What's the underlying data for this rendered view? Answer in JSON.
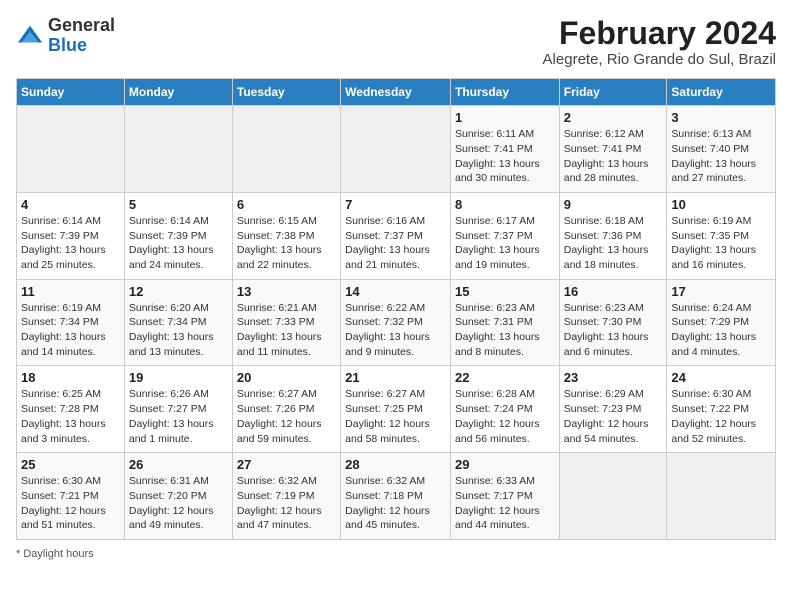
{
  "logo": {
    "general": "General",
    "blue": "Blue"
  },
  "header": {
    "month_year": "February 2024",
    "location": "Alegrete, Rio Grande do Sul, Brazil"
  },
  "days_of_week": [
    "Sunday",
    "Monday",
    "Tuesday",
    "Wednesday",
    "Thursday",
    "Friday",
    "Saturday"
  ],
  "weeks": [
    [
      {
        "num": "",
        "info": ""
      },
      {
        "num": "",
        "info": ""
      },
      {
        "num": "",
        "info": ""
      },
      {
        "num": "",
        "info": ""
      },
      {
        "num": "1",
        "info": "Sunrise: 6:11 AM\nSunset: 7:41 PM\nDaylight: 13 hours and 30 minutes."
      },
      {
        "num": "2",
        "info": "Sunrise: 6:12 AM\nSunset: 7:41 PM\nDaylight: 13 hours and 28 minutes."
      },
      {
        "num": "3",
        "info": "Sunrise: 6:13 AM\nSunset: 7:40 PM\nDaylight: 13 hours and 27 minutes."
      }
    ],
    [
      {
        "num": "4",
        "info": "Sunrise: 6:14 AM\nSunset: 7:39 PM\nDaylight: 13 hours and 25 minutes."
      },
      {
        "num": "5",
        "info": "Sunrise: 6:14 AM\nSunset: 7:39 PM\nDaylight: 13 hours and 24 minutes."
      },
      {
        "num": "6",
        "info": "Sunrise: 6:15 AM\nSunset: 7:38 PM\nDaylight: 13 hours and 22 minutes."
      },
      {
        "num": "7",
        "info": "Sunrise: 6:16 AM\nSunset: 7:37 PM\nDaylight: 13 hours and 21 minutes."
      },
      {
        "num": "8",
        "info": "Sunrise: 6:17 AM\nSunset: 7:37 PM\nDaylight: 13 hours and 19 minutes."
      },
      {
        "num": "9",
        "info": "Sunrise: 6:18 AM\nSunset: 7:36 PM\nDaylight: 13 hours and 18 minutes."
      },
      {
        "num": "10",
        "info": "Sunrise: 6:19 AM\nSunset: 7:35 PM\nDaylight: 13 hours and 16 minutes."
      }
    ],
    [
      {
        "num": "11",
        "info": "Sunrise: 6:19 AM\nSunset: 7:34 PM\nDaylight: 13 hours and 14 minutes."
      },
      {
        "num": "12",
        "info": "Sunrise: 6:20 AM\nSunset: 7:34 PM\nDaylight: 13 hours and 13 minutes."
      },
      {
        "num": "13",
        "info": "Sunrise: 6:21 AM\nSunset: 7:33 PM\nDaylight: 13 hours and 11 minutes."
      },
      {
        "num": "14",
        "info": "Sunrise: 6:22 AM\nSunset: 7:32 PM\nDaylight: 13 hours and 9 minutes."
      },
      {
        "num": "15",
        "info": "Sunrise: 6:23 AM\nSunset: 7:31 PM\nDaylight: 13 hours and 8 minutes."
      },
      {
        "num": "16",
        "info": "Sunrise: 6:23 AM\nSunset: 7:30 PM\nDaylight: 13 hours and 6 minutes."
      },
      {
        "num": "17",
        "info": "Sunrise: 6:24 AM\nSunset: 7:29 PM\nDaylight: 13 hours and 4 minutes."
      }
    ],
    [
      {
        "num": "18",
        "info": "Sunrise: 6:25 AM\nSunset: 7:28 PM\nDaylight: 13 hours and 3 minutes."
      },
      {
        "num": "19",
        "info": "Sunrise: 6:26 AM\nSunset: 7:27 PM\nDaylight: 13 hours and 1 minute."
      },
      {
        "num": "20",
        "info": "Sunrise: 6:27 AM\nSunset: 7:26 PM\nDaylight: 12 hours and 59 minutes."
      },
      {
        "num": "21",
        "info": "Sunrise: 6:27 AM\nSunset: 7:25 PM\nDaylight: 12 hours and 58 minutes."
      },
      {
        "num": "22",
        "info": "Sunrise: 6:28 AM\nSunset: 7:24 PM\nDaylight: 12 hours and 56 minutes."
      },
      {
        "num": "23",
        "info": "Sunrise: 6:29 AM\nSunset: 7:23 PM\nDaylight: 12 hours and 54 minutes."
      },
      {
        "num": "24",
        "info": "Sunrise: 6:30 AM\nSunset: 7:22 PM\nDaylight: 12 hours and 52 minutes."
      }
    ],
    [
      {
        "num": "25",
        "info": "Sunrise: 6:30 AM\nSunset: 7:21 PM\nDaylight: 12 hours and 51 minutes."
      },
      {
        "num": "26",
        "info": "Sunrise: 6:31 AM\nSunset: 7:20 PM\nDaylight: 12 hours and 49 minutes."
      },
      {
        "num": "27",
        "info": "Sunrise: 6:32 AM\nSunset: 7:19 PM\nDaylight: 12 hours and 47 minutes."
      },
      {
        "num": "28",
        "info": "Sunrise: 6:32 AM\nSunset: 7:18 PM\nDaylight: 12 hours and 45 minutes."
      },
      {
        "num": "29",
        "info": "Sunrise: 6:33 AM\nSunset: 7:17 PM\nDaylight: 12 hours and 44 minutes."
      },
      {
        "num": "",
        "info": ""
      },
      {
        "num": "",
        "info": ""
      }
    ]
  ],
  "footer": {
    "note": "Daylight hours"
  }
}
